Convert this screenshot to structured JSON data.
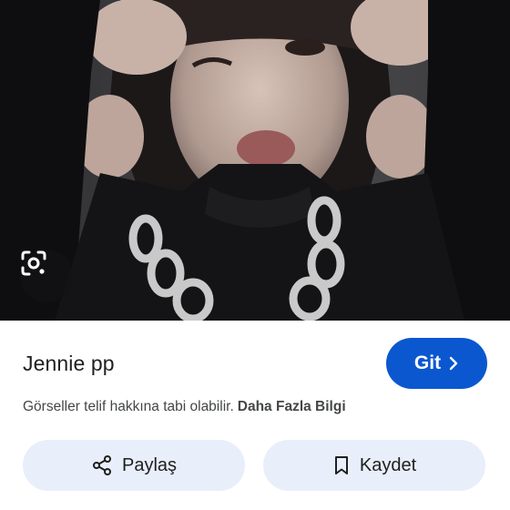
{
  "result": {
    "title": "Jennie pp",
    "notice": "Görseller telif hakkına tabi olabilir.",
    "more_info": "Daha Fazla Bilgi"
  },
  "buttons": {
    "visit_label": "Git",
    "share_label": "Paylaş",
    "save_label": "Kaydet"
  },
  "icons": {
    "lens": "lens-camera-icon",
    "visit": "chevron-right-icon",
    "share": "share-icon",
    "save": "bookmark-icon"
  },
  "colors": {
    "primary": "#0b57d0",
    "tonal_button": "#e8eefa",
    "text_primary": "#1f1f1f",
    "text_secondary": "#444746"
  }
}
